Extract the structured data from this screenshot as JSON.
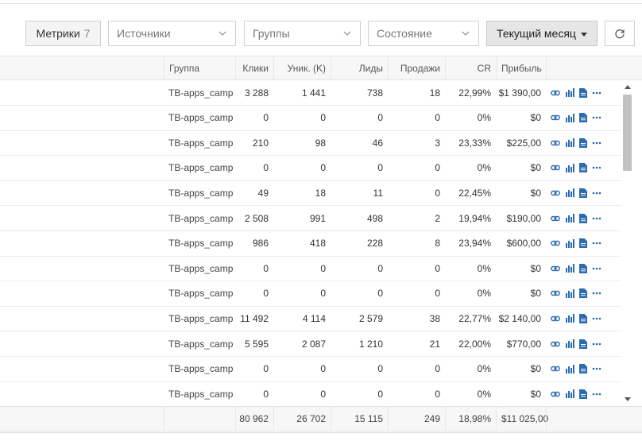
{
  "toolbar": {
    "metrics_label": "Метрики",
    "metrics_count": "7",
    "sources_placeholder": "Источники",
    "groups_placeholder": "Группы",
    "state_placeholder": "Состояние",
    "period_label": "Текущий месяц"
  },
  "table": {
    "headers": {
      "group": "Группа",
      "clicks": "Клики",
      "uniques": "Уник. (K)",
      "leads": "Лиды",
      "sales": "Продажи",
      "cr": "CR",
      "profit": "Прибыль"
    },
    "rows": [
      {
        "group": "TB-apps_camp",
        "clicks": "3 288",
        "uniques": "1 441",
        "leads": "738",
        "sales": "18",
        "cr": "22,99%",
        "profit": "$1 390,00"
      },
      {
        "group": "TB-apps_camp",
        "clicks": "0",
        "uniques": "0",
        "leads": "0",
        "sales": "0",
        "cr": "0%",
        "profit": "$0"
      },
      {
        "group": "TB-apps_camp",
        "clicks": "210",
        "uniques": "98",
        "leads": "46",
        "sales": "3",
        "cr": "23,33%",
        "profit": "$225,00"
      },
      {
        "group": "TB-apps_camp",
        "clicks": "0",
        "uniques": "0",
        "leads": "0",
        "sales": "0",
        "cr": "0%",
        "profit": "$0"
      },
      {
        "group": "TB-apps_camp",
        "clicks": "49",
        "uniques": "18",
        "leads": "11",
        "sales": "0",
        "cr": "22,45%",
        "profit": "$0"
      },
      {
        "group": "TB-apps_camp",
        "clicks": "2 508",
        "uniques": "991",
        "leads": "498",
        "sales": "2",
        "cr": "19,94%",
        "profit": "$190,00"
      },
      {
        "group": "TB-apps_camp",
        "clicks": "986",
        "uniques": "418",
        "leads": "228",
        "sales": "8",
        "cr": "23,94%",
        "profit": "$600,00"
      },
      {
        "group": "TB-apps_camp",
        "clicks": "0",
        "uniques": "0",
        "leads": "0",
        "sales": "0",
        "cr": "0%",
        "profit": "$0"
      },
      {
        "group": "TB-apps_camp",
        "clicks": "0",
        "uniques": "0",
        "leads": "0",
        "sales": "0",
        "cr": "0%",
        "profit": "$0"
      },
      {
        "group": "TB-apps_camp",
        "clicks": "11 492",
        "uniques": "4 114",
        "leads": "2 579",
        "sales": "38",
        "cr": "22,77%",
        "profit": "$2 140,00"
      },
      {
        "group": "TB-apps_camp",
        "clicks": "5 595",
        "uniques": "2 087",
        "leads": "1 210",
        "sales": "21",
        "cr": "22,00%",
        "profit": "$770,00"
      },
      {
        "group": "TB-apps_camp",
        "clicks": "0",
        "uniques": "0",
        "leads": "0",
        "sales": "0",
        "cr": "0%",
        "profit": "$0"
      },
      {
        "group": "TB-apps_camp",
        "clicks": "0",
        "uniques": "0",
        "leads": "0",
        "sales": "0",
        "cr": "0%",
        "profit": "$0"
      }
    ],
    "totals": {
      "clicks": "80 962",
      "uniques": "26 702",
      "leads": "15 115",
      "sales": "249",
      "cr": "18,98%",
      "profit": "$11 025,00"
    }
  },
  "icons": {
    "row_actions": [
      "link-icon",
      "bar-chart-icon",
      "document-icon",
      "more-icon"
    ],
    "accent": "#2b6cb0"
  }
}
